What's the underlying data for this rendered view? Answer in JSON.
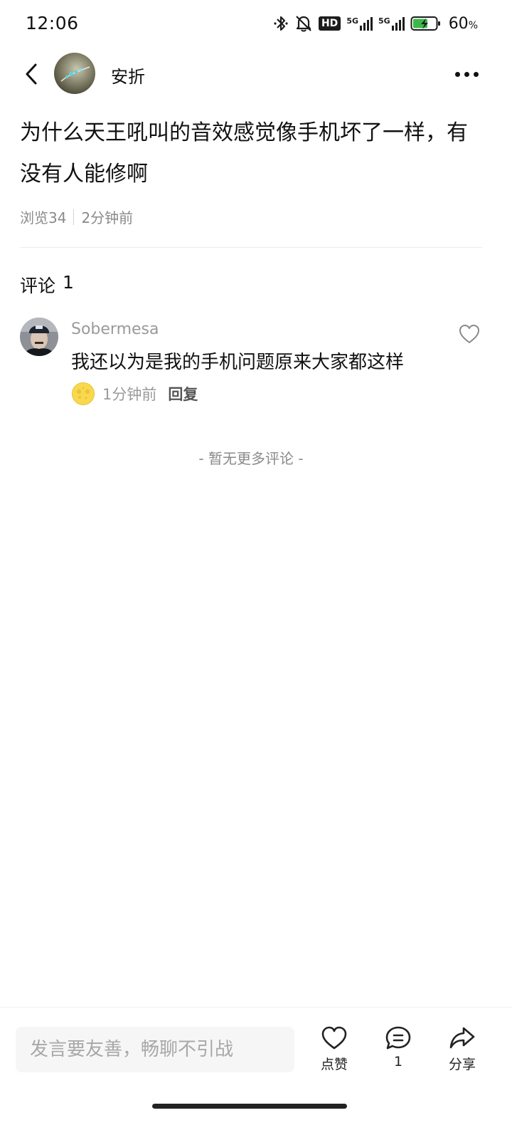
{
  "status_bar": {
    "time": "12:06",
    "hd_label": "HD",
    "signal1_label": "5G",
    "signal2_label": "5G",
    "battery_percent": "60",
    "battery_unit": "%"
  },
  "header": {
    "author_name": "安折"
  },
  "post": {
    "title": "为什么天王吼叫的音效感觉像手机坏了一样，有没有人能修啊",
    "views": "浏览34",
    "time": "2分钟前"
  },
  "comments_section": {
    "heading": "评论",
    "count": "1",
    "items": [
      {
        "author": "Sobermesa",
        "text": "我还以为是我的手机问题原来大家都这样",
        "time": "1分钟前",
        "reply_label": "回复"
      }
    ],
    "no_more_text": "- 暂无更多评论 -"
  },
  "bottom_bar": {
    "input_placeholder": "发言要友善，畅聊不引战",
    "like_label": "点赞",
    "comment_count": "1",
    "share_label": "分享"
  },
  "colors": {
    "text_primary": "#111111",
    "text_secondary": "#8a8a8a",
    "divider": "#ececec",
    "emoji_yellow": "#f8d94e",
    "battery_green": "#3cb84a"
  },
  "icons": [
    "back-arrow-icon",
    "more-dots-icon",
    "heart-icon",
    "comment-bubble-icon",
    "share-arrow-icon",
    "bluetooth-icon",
    "mute-bell-icon",
    "battery-charging-icon",
    "emoji-face-icon"
  ]
}
